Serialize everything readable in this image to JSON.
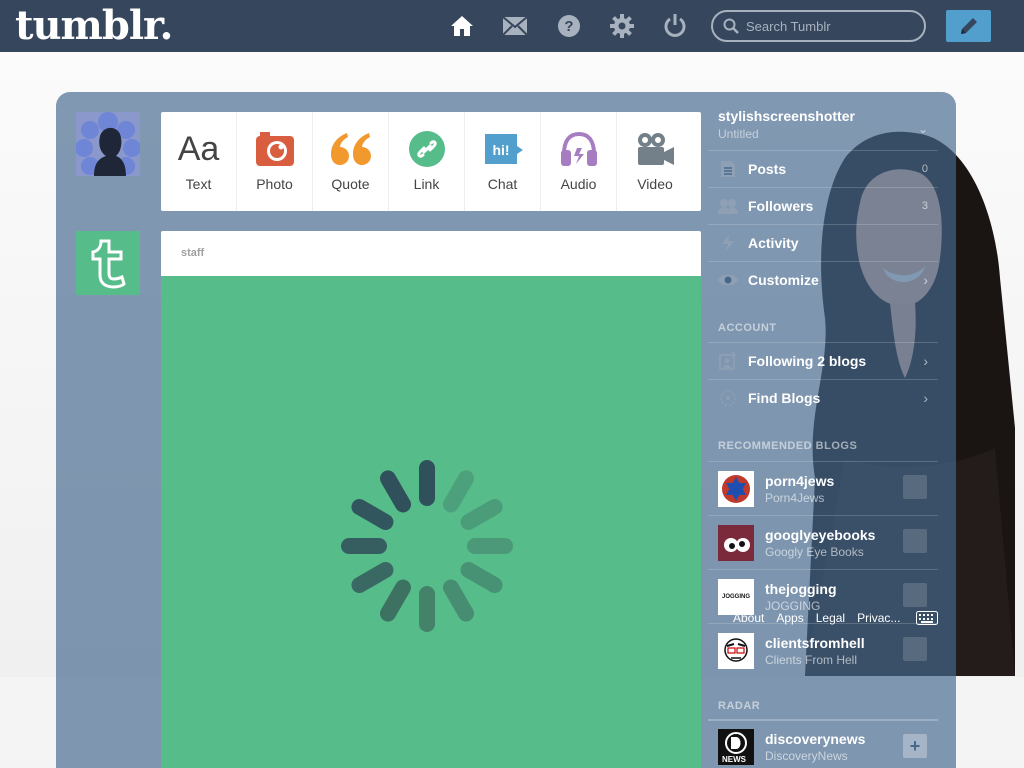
{
  "header": {
    "logo": "tumblr.",
    "search_placeholder": "Search Tumblr",
    "nav_icons": [
      "home-icon",
      "mail-icon",
      "help-icon",
      "gear-icon",
      "power-icon"
    ]
  },
  "post_types": [
    {
      "label": "Text",
      "icon": "text-icon",
      "color": "#444444"
    },
    {
      "label": "Photo",
      "icon": "camera-icon",
      "color": "#d95e40"
    },
    {
      "label": "Quote",
      "icon": "quote-icon",
      "color": "#f2992e"
    },
    {
      "label": "Link",
      "icon": "link-icon",
      "color": "#56bc8a"
    },
    {
      "label": "Chat",
      "icon": "chat-icon",
      "color": "#529ecc"
    },
    {
      "label": "Audio",
      "icon": "headphones-icon",
      "color": "#a77dc2"
    },
    {
      "label": "Video",
      "icon": "video-camera-icon",
      "color": "#748089"
    }
  ],
  "post": {
    "author": "staff",
    "body_color": "#56bc8a"
  },
  "sidebar": {
    "blog_name": "stylishscreenshotter",
    "blog_subtitle": "Untitled",
    "items": [
      {
        "label": "Posts",
        "count": "0",
        "icon": "posts-icon"
      },
      {
        "label": "Followers",
        "count": "3",
        "icon": "followers-icon"
      },
      {
        "label": "Activity",
        "icon": "activity-icon"
      },
      {
        "label": "Customize",
        "icon": "eye-icon"
      }
    ],
    "account_heading": "ACCOUNT",
    "account_items": [
      {
        "label": "Following 2 blogs",
        "icon": "following-icon"
      },
      {
        "label": "Find Blogs",
        "icon": "find-blogs-icon"
      }
    ],
    "recommended_heading": "RECOMMENDED BLOGS",
    "recommended": [
      {
        "name": "porn4jews",
        "title": "Porn4Jews"
      },
      {
        "name": "googlyeyebooks",
        "title": "Googly Eye Books"
      },
      {
        "name": "thejogging",
        "title": "JOGGING"
      },
      {
        "name": "clientsfromhell",
        "title": "Clients From Hell"
      }
    ],
    "footer_links": [
      "About",
      "Apps",
      "Legal",
      "Privac..."
    ],
    "radar_heading": "RADAR",
    "radar": {
      "name": "discoverynews",
      "title": "DiscoveryNews",
      "badge": "NEWS"
    },
    "jogging_avatar_text": "JOGGING"
  },
  "colors": {
    "header": "#36465d",
    "accent": "#529ecc",
    "staff_green": "#56bc8a"
  }
}
